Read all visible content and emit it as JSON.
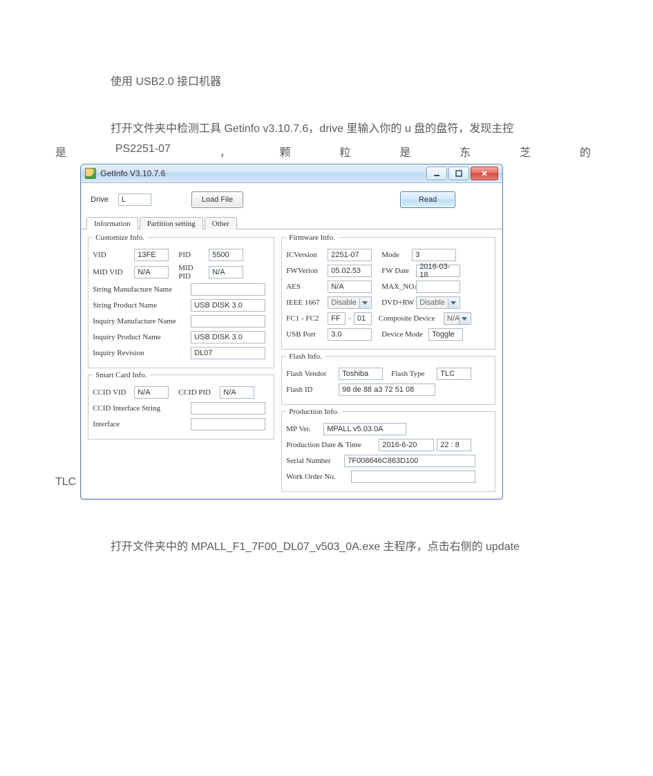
{
  "doc": {
    "line1": "使用 USB2.0 接口机器",
    "line2": "打开文件夹中检测工具 Getinfo v3.10.7.6，drive 里输入你的 u 盘的盘符，发现主控",
    "just": [
      "是",
      "PS2251-07",
      "，",
      "颗",
      "粒",
      "是",
      "东",
      "芝",
      "的"
    ],
    "tlc": "TLC",
    "line3": "打开文件夹中的 MPALL_F1_7F00_DL07_v503_0A.exe 主程序，点击右侧的 update"
  },
  "win": {
    "title": "GetInfo V3.10.7.6",
    "toolbar": {
      "drive_label": "Drive",
      "drive_value": "L",
      "load_file": "Load File",
      "read": "Read"
    },
    "tabs": [
      "Information",
      "Partition setting",
      "Other"
    ],
    "customize": {
      "legend": "Customize Info.",
      "vid_l": "VID",
      "vid": "13FE",
      "pid_l": "PID",
      "pid": "5500",
      "midvid_l": "MID VID",
      "midvid": "N/A",
      "midpid_l": "MID PID",
      "midpid": "N/A",
      "smfg_l": "String Manufacture Name",
      "smfg": "",
      "sprod_l": "String Product Name",
      "sprod": "USB DISK 3.0",
      "imfg_l": "Inquiry Manufacture Name",
      "imfg": "",
      "iprod_l": "Inquiry Product Name",
      "iprod": "USB DISK 3.0",
      "irev_l": "Inquiry Revision",
      "irev": "DL07"
    },
    "smart": {
      "legend": "Smart Card Info.",
      "ccidvid_l": "CCID VID",
      "ccidvid": "N/A",
      "ccidpid_l": "CCID PID",
      "ccidpid": "N/A",
      "ccidifs_l": "CCID Interface String",
      "ccidifs": "",
      "iface_l": "Interface",
      "iface": ""
    },
    "fw": {
      "legend": "Firmware Info.",
      "icver_l": "ICVersion",
      "icver": "2251-07",
      "mode_l": "Mode",
      "mode": "3",
      "fwver_l": "FWVerion",
      "fwver": "05.02.53",
      "fwdate_l": "FW Date",
      "fwdate": "2016-03-18",
      "aes_l": "AES",
      "aes": "N/A",
      "maxnoa_l": "MAX_NOA",
      "maxnoa": "",
      "ieee_l": "IEEE 1667",
      "ieee": "Disable",
      "dvdrw_l": "DVD+RW",
      "dvdrw": "Disable",
      "fc_l": "FC1 - FC2",
      "fc1": "FF",
      "fc_dash": "-",
      "fc2": "01",
      "compdev_l": "Composite Device",
      "compdev": "N/A",
      "usbport_l": "USB Port",
      "usbport": "3.0",
      "devmode_l": "Device Mode",
      "devmode": "Toggle"
    },
    "flash": {
      "legend": "Flash Info.",
      "vendor_l": "Flash Vendor",
      "vendor": "Toshiba",
      "type_l": "Flash Type",
      "type": "TLC",
      "id_l": "Flash ID",
      "id": "98 de 88 a3 72 51 08"
    },
    "prod": {
      "legend": "Production Info.",
      "mpver_l": "MP Ver.",
      "mpver": "MPALL v5.03.0A",
      "pdt_l": "Production Date & Time",
      "pdate": "2016-6-20",
      "ptime": "22 : 8",
      "sn_l": "Serial Number",
      "sn": "7F008646C863D100",
      "wo_l": "Work Order No.",
      "wo": ""
    }
  }
}
